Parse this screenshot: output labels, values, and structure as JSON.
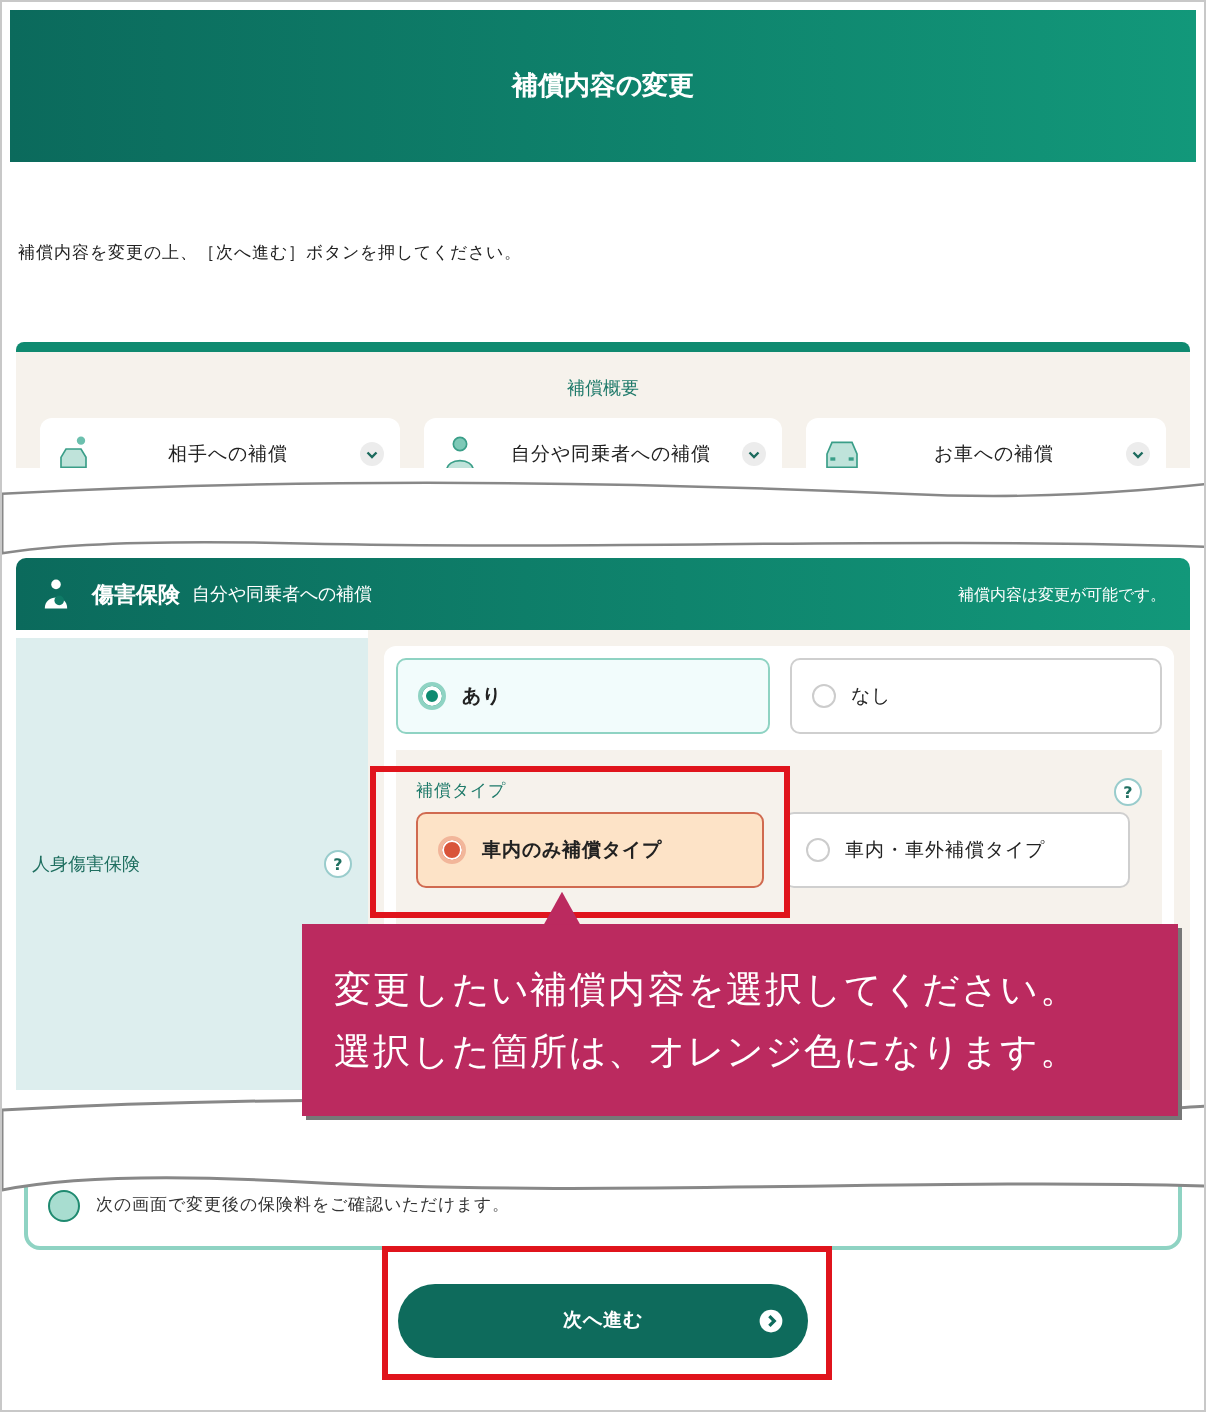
{
  "header": {
    "title": "補償内容の変更"
  },
  "instruction": "補償内容を変更の上、［次へ進む］ボタンを押してください。",
  "summary": {
    "title": "補償概要",
    "cards": [
      {
        "label": "相手への補償"
      },
      {
        "label": "自分や同乗者への補償"
      },
      {
        "label": "お車への補償"
      }
    ]
  },
  "section": {
    "title": "傷害保険",
    "subtitle": "自分や同乗者への補償",
    "note": "補償内容は変更が可能です。",
    "item": {
      "label": "人身傷害保険",
      "help": "?",
      "options": [
        {
          "label": "あり",
          "selected": true
        },
        {
          "label": "なし",
          "selected": false
        }
      ],
      "type_group": {
        "title": "補償タイプ",
        "help": "?",
        "options": [
          {
            "label": "車内のみ補償タイプ",
            "selected": true
          },
          {
            "label": "車内・車外補償タイプ",
            "selected": false
          }
        ]
      }
    }
  },
  "confirm_note": "次の画面で変更後の保険料をご確認いただけます。",
  "next_button": {
    "label": "次へ進む"
  },
  "callout": {
    "lines": [
      "変更したい補償内容を選択してください。",
      "選択した箇所は、オレンジ色になります。"
    ]
  }
}
